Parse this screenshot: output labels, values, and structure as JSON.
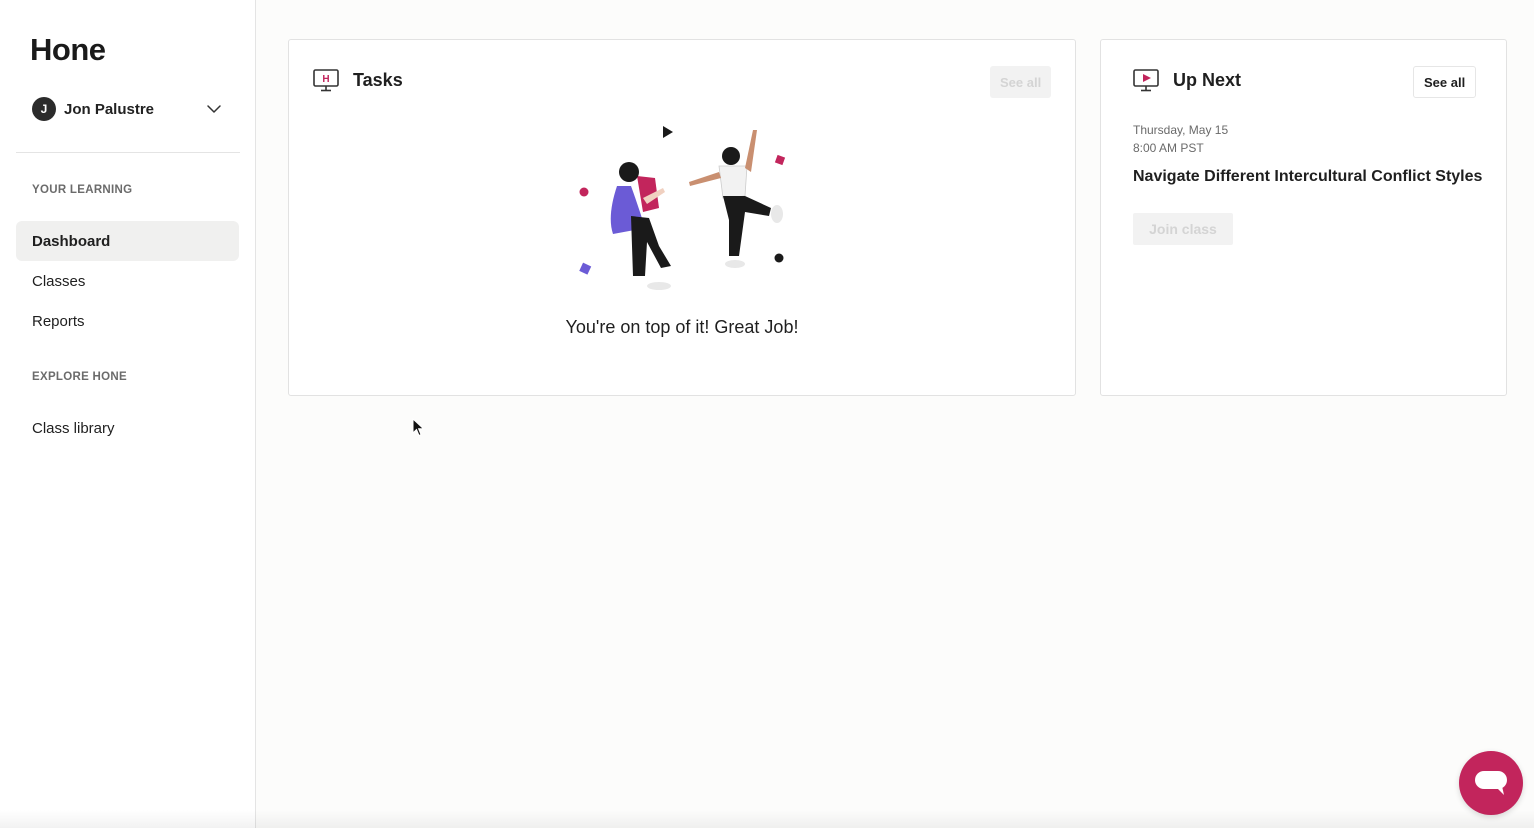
{
  "app": {
    "logo": "Hone"
  },
  "user": {
    "initial": "J",
    "name": "Jon Palustre"
  },
  "sidebar": {
    "section_learning": "YOUR LEARNING",
    "items": [
      {
        "label": "Dashboard",
        "active": true
      },
      {
        "label": "Classes",
        "active": false
      },
      {
        "label": "Reports",
        "active": false
      }
    ],
    "section_explore": "EXPLORE HONE",
    "explore_items": [
      {
        "label": "Class library"
      }
    ]
  },
  "tasks": {
    "title": "Tasks",
    "see_all": "See all",
    "icon": "monitor-h-icon",
    "empty_message": "You're on top of it! Great Job!"
  },
  "up_next": {
    "title": "Up Next",
    "see_all": "See all",
    "icon": "monitor-play-icon",
    "date": "Thursday, May 15",
    "time": "8:00 AM PST",
    "class_title": "Navigate Different Intercultural Conflict Styles",
    "join_label": "Join class"
  },
  "colors": {
    "brand": "#c2255c",
    "accent_purple": "#6b5bd6",
    "active_nav_bg": "#f0f0ef"
  }
}
